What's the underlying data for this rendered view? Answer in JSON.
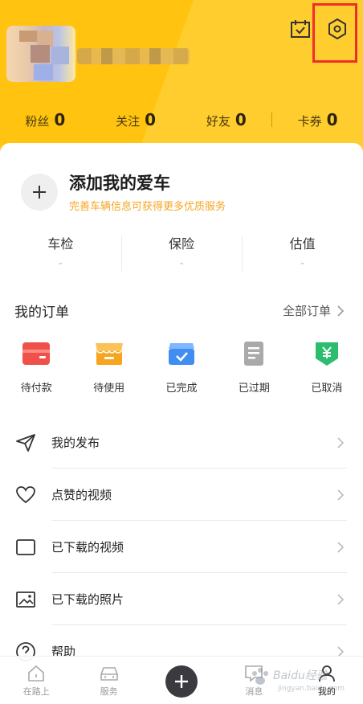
{
  "header": {
    "stats": [
      {
        "label": "粉丝",
        "value": "0"
      },
      {
        "label": "关注",
        "value": "0"
      },
      {
        "label": "好友",
        "value": "0"
      },
      {
        "label": "卡券",
        "value": "0"
      }
    ],
    "icons": {
      "calendar": "calendar-check-icon",
      "settings": "hexagon-settings-icon"
    },
    "highlight_color": "#ee2d2d",
    "bg_color": "#ffc310"
  },
  "car": {
    "title": "添加我的爱车",
    "subtitle": "完善车辆信息可获得更多优质服务",
    "stats": [
      {
        "label": "车检",
        "value": "-"
      },
      {
        "label": "保险",
        "value": "-"
      },
      {
        "label": "估值",
        "value": "-"
      }
    ]
  },
  "orders": {
    "title": "我的订单",
    "all_label": "全部订单",
    "items": [
      {
        "label": "待付款",
        "icon": "wallet-icon",
        "color": "#f0504a"
      },
      {
        "label": "待使用",
        "icon": "shop-icon",
        "color": "#f7a51e"
      },
      {
        "label": "已完成",
        "icon": "box-check-icon",
        "color": "#3f8ef0"
      },
      {
        "label": "已过期",
        "icon": "document-icon",
        "color": "#a9a9a9"
      },
      {
        "label": "已取消",
        "icon": "yuan-shield-icon",
        "color": "#2dbd6e"
      }
    ]
  },
  "menu": [
    {
      "label": "我的发布",
      "icon": "send-icon"
    },
    {
      "label": "点赞的视频",
      "icon": "heart-icon"
    },
    {
      "label": "已下载的视频",
      "icon": "video-icon"
    },
    {
      "label": "已下载的照片",
      "icon": "photo-icon"
    },
    {
      "label": "帮助",
      "icon": "help-icon"
    }
  ],
  "tabbar": {
    "tabs": [
      {
        "label": "在路上",
        "icon": "home-icon"
      },
      {
        "label": "服务",
        "icon": "car-icon"
      },
      {
        "label": "",
        "icon": "plus-icon"
      },
      {
        "label": "消息",
        "icon": "message-icon"
      },
      {
        "label": "我的",
        "icon": "person-icon"
      }
    ]
  },
  "watermark": {
    "text": "Baidu经验",
    "sub": "jingyan.baidu.com"
  }
}
